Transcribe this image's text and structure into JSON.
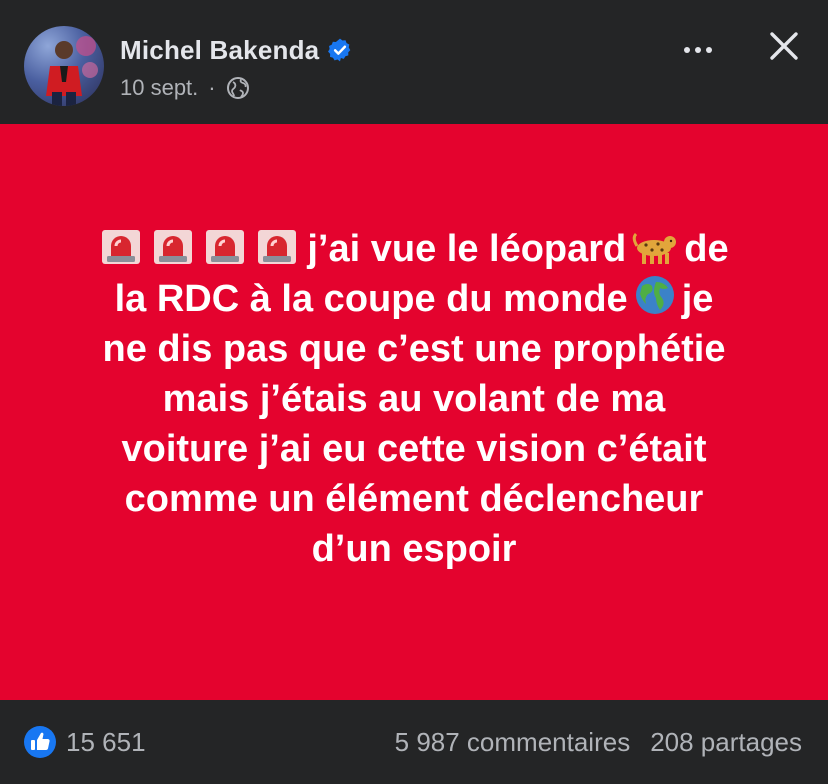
{
  "post": {
    "author": "Michel Bakenda",
    "date": "10 sept.",
    "separator": "·",
    "text_line1": "j’ai vue le léopard",
    "text_line1_end": "de",
    "text_line2": "la RDC à la coupe du monde",
    "text_line2_end": "je",
    "text_line3": "ne dis pas que c’est une prophétie",
    "text_line4": "mais j’étais au volant de ma",
    "text_line5": "voiture j’ai eu cette vision c’était",
    "text_line6": "comme un élément déclencheur",
    "text_line7": "d’un espoir",
    "background_color": "#e4032e"
  },
  "icons": {
    "verified": "verified-badge-icon",
    "privacy": "globe-icon",
    "more": "more-options-icon",
    "close": "close-icon",
    "siren": "rotating-light-emoji",
    "leopard": "leopard-emoji",
    "earth": "earth-globe-emoji",
    "like": "like-reaction-icon"
  },
  "footer": {
    "likes": "15 651",
    "comments": "5 987 commentaires",
    "shares": "208 partages"
  },
  "colors": {
    "accent": "#1877f2"
  }
}
